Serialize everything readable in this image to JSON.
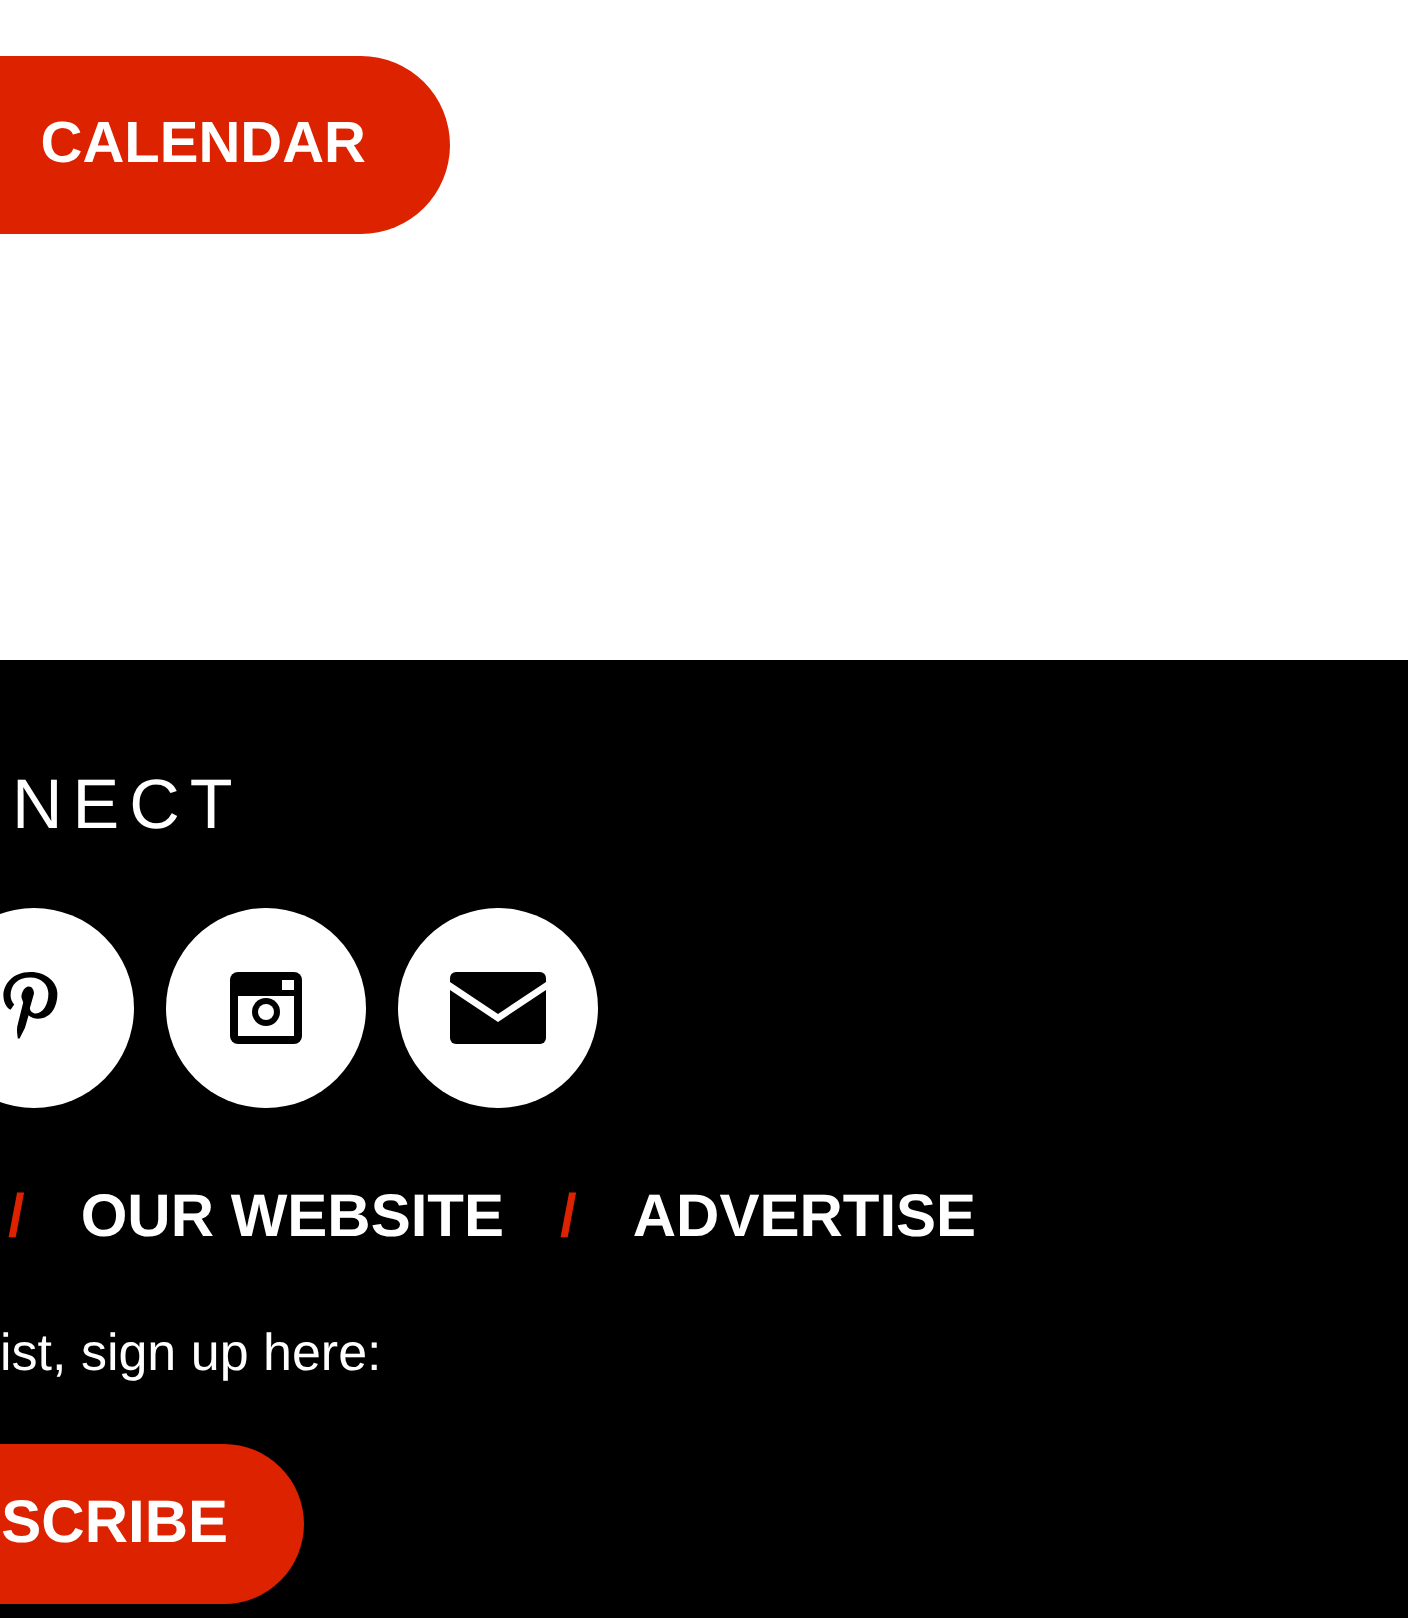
{
  "calendar_button": "CALENDAR",
  "footer": {
    "heading": "NECT",
    "social_icons": [
      {
        "kind": "pinterest"
      },
      {
        "kind": "instagram"
      },
      {
        "kind": "email"
      }
    ],
    "nav": [
      {
        "kind": "separator",
        "text": "/"
      },
      {
        "kind": "link",
        "text": "OUR WEBSITE"
      },
      {
        "kind": "separator",
        "text": "/"
      },
      {
        "kind": "link",
        "text": "ADVERTISE"
      }
    ],
    "signup_text": "ist, sign up here:",
    "subscribe_button": "SCRIBE"
  }
}
